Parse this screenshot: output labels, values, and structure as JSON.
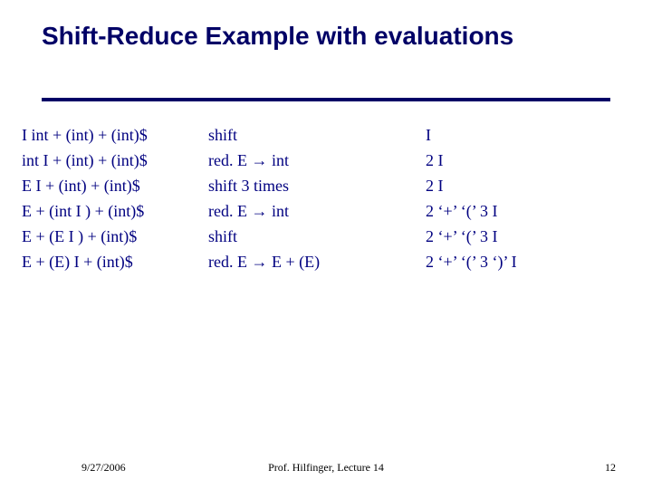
{
  "title": "Shift-Reduce Example with evaluations",
  "rows": [
    {
      "stack": "I int + (int) + (int)$",
      "action_pre": "shift",
      "action_red": "",
      "eval": "I"
    },
    {
      "stack": "int I + (int) + (int)$",
      "action_pre": "red. E ",
      "action_red": " int",
      "eval": "2 I"
    },
    {
      "stack": "E I + (int) + (int)$",
      "action_pre": "shift 3 times",
      "action_red": "",
      "eval": "2 I"
    },
    {
      "stack": "E + (int I ) + (int)$",
      "action_pre": "red. E ",
      "action_red": " int",
      "eval": "2 ‘+’ ‘(’ 3 I"
    },
    {
      "stack": "E + (E I ) + (int)$",
      "action_pre": "shift",
      "action_red": "",
      "eval": "2 ‘+’ ‘(’ 3 I"
    },
    {
      "stack": "E + (E) I + (int)$",
      "action_pre": "red. E ",
      "action_red": " E + (E)",
      "eval": "2 ‘+’ ‘(’ 3 ‘)’ I"
    }
  ],
  "footer": {
    "date": "9/27/2006",
    "center": "Prof. Hilfinger, Lecture 14",
    "page": "12"
  }
}
